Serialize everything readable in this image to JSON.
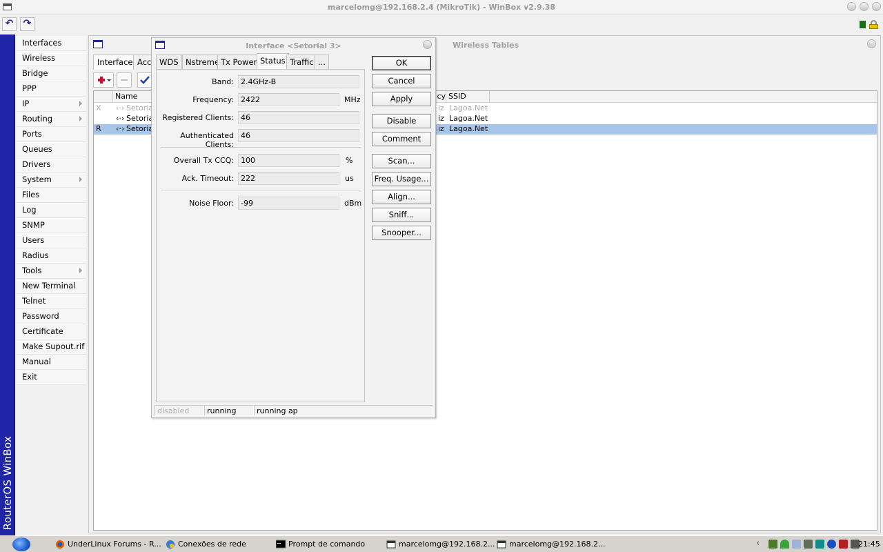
{
  "window": {
    "title": "marcelomg@192.168.2.4 (MikroTik) - WinBox v2.9.38"
  },
  "toolbar": {
    "undo_glyph": "↶",
    "redo_glyph": "↷"
  },
  "brand": "RouterOS WinBox",
  "menu": {
    "items": [
      {
        "label": "Interfaces"
      },
      {
        "label": "Wireless"
      },
      {
        "label": "Bridge"
      },
      {
        "label": "PPP"
      },
      {
        "label": "IP"
      },
      {
        "label": "Routing"
      },
      {
        "label": "Ports"
      },
      {
        "label": "Queues"
      },
      {
        "label": "Drivers"
      },
      {
        "label": "System"
      },
      {
        "label": "Files"
      },
      {
        "label": "Log"
      },
      {
        "label": "SNMP"
      },
      {
        "label": "Users"
      },
      {
        "label": "Radius"
      },
      {
        "label": "Tools"
      },
      {
        "label": "New Terminal"
      },
      {
        "label": "Telnet"
      },
      {
        "label": "Password"
      },
      {
        "label": "Certificate"
      },
      {
        "label": "Make Supout.rif"
      },
      {
        "label": "Manual"
      },
      {
        "label": "Exit"
      }
    ]
  },
  "wireless_tables": {
    "title": "Wireless Tables",
    "tabs": [
      "Interfaces",
      "Acc"
    ],
    "columns": [
      "Name",
      "...cy",
      "SSID"
    ],
    "col_partial": "cy",
    "rows": [
      {
        "flag": "X",
        "name": "Setorial",
        "freq": "iz",
        "ssid": "Lagoa.Net"
      },
      {
        "flag": "",
        "name": "Setorial",
        "freq": "iz",
        "ssid": "Lagoa.Net"
      },
      {
        "flag": "R",
        "name": "Setorial",
        "freq": "iz",
        "ssid": "Lagoa.Net"
      }
    ]
  },
  "dialog": {
    "title": "Interface <Setorial 3>",
    "tabs": [
      "WDS",
      "Nstreme",
      "Tx Power",
      "Status",
      "Traffic",
      "..."
    ],
    "active_tab": "Status",
    "fields": {
      "band_label": "Band:",
      "band_value": "2.4GHz-B",
      "frequency_label": "Frequency:",
      "frequency_value": "2422",
      "frequency_unit": "MHz",
      "registered_label": "Registered Clients:",
      "registered_value": "46",
      "authenticated_label": "Authenticated Clients:",
      "authenticated_value": "46",
      "ccq_label": "Overall Tx CCQ:",
      "ccq_value": "100",
      "ccq_unit": "%",
      "ack_label": "Ack. Timeout:",
      "ack_value": "222",
      "ack_unit": "us",
      "noise_label": "Noise Floor:",
      "noise_value": "-99",
      "noise_unit": "dBm"
    },
    "buttons": {
      "ok": "OK",
      "cancel": "Cancel",
      "apply": "Apply",
      "disable": "Disable",
      "comment": "Comment",
      "scan": "Scan...",
      "freq_usage": "Freq. Usage...",
      "align": "Align...",
      "sniff": "Sniff...",
      "snooper": "Snooper..."
    },
    "status": {
      "disabled": "disabled",
      "running": "running",
      "mode": "running ap"
    }
  },
  "taskbar": {
    "tasks": [
      {
        "label": "UnderLinux Forums - R...",
        "icon": "firefox-icon"
      },
      {
        "label": "Conexões de rede",
        "icon": "network-icon"
      },
      {
        "label": "Prompt de comando",
        "icon": "console-icon"
      },
      {
        "label": "marcelomg@192.168.2...",
        "icon": "winbox-icon"
      },
      {
        "label": "marcelomg@192.168.2...",
        "icon": "winbox-icon"
      }
    ],
    "clock": "21:45",
    "tray_chevron": "‹"
  },
  "colors": {
    "brand_blue": "#1f25a6",
    "selection": "#a6c5e8",
    "ui_background": "#f0f0f0"
  }
}
